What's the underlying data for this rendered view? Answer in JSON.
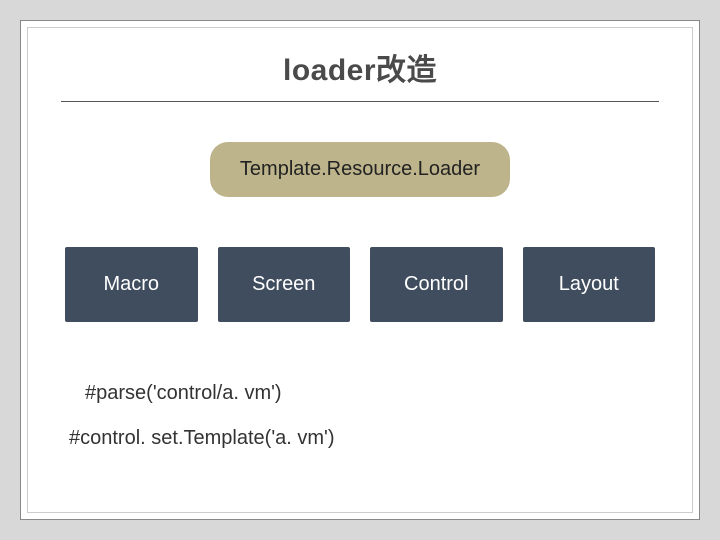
{
  "title": "loader改造",
  "top_box": "Template.Resource.Loader",
  "boxes": [
    "Macro",
    "Screen",
    "Control",
    "Layout"
  ],
  "code_line_1": "#parse('control/a. vm')",
  "code_line_2": "#control. set.Template('a. vm')"
}
